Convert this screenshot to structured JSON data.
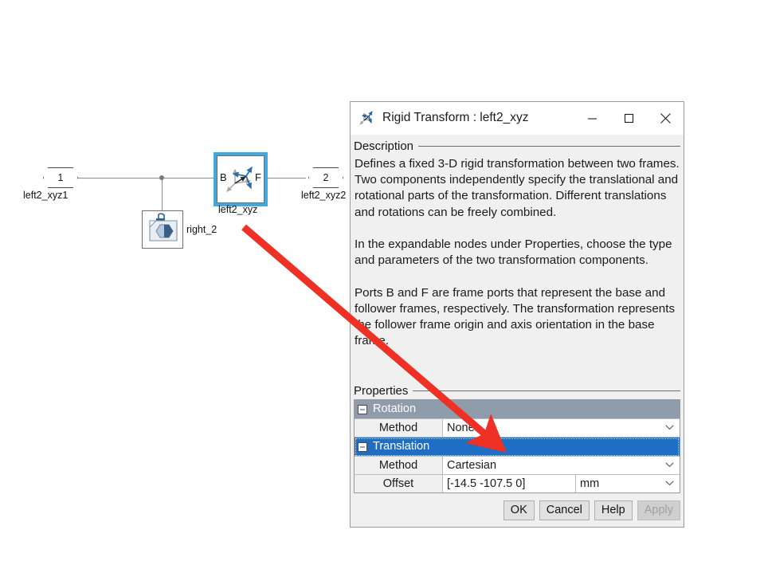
{
  "diagram": {
    "input_port": {
      "number": "1",
      "label": "left2_xyz1"
    },
    "output_port": {
      "number": "2",
      "label": "left2_xyz2"
    },
    "transform_block": {
      "label": "left2_xyz",
      "base_port": "B",
      "follower_port": "F",
      "icon": "rigid-transform-axes-icon",
      "selected": "true",
      "selection_color": "#3fa9e0"
    },
    "solid_block": {
      "label": "right_2",
      "icon": "file-solid-icon"
    },
    "annotation": {
      "type": "arrow",
      "color": "#ee3124",
      "points_to": "Translation"
    }
  },
  "dialog": {
    "title": "Rigid Transform : left2_xyz",
    "icon": "rigid-transform-axes-icon",
    "window_buttons": {
      "minimize": "minimize-icon",
      "maximize": "maximize-icon",
      "close": "close-icon"
    },
    "description": {
      "group_label": "Description",
      "text": "Defines a fixed 3-D rigid transformation between two frames. Two components independently specify the translational and rotational parts of the transformation. Different translations and rotations can be freely combined.\n\nIn the expandable nodes under Properties, choose the type and parameters of the two transformation components.\n\nPorts B and F are frame ports that represent the base and follower frames, respectively. The transformation represents the follower frame origin and axis orientation in the base frame."
    },
    "properties": {
      "group_label": "Properties",
      "rows": [
        {
          "kind": "group",
          "name": "Rotation",
          "expanded": "true",
          "selected": "false"
        },
        {
          "kind": "field",
          "label": "Method",
          "value": "None",
          "control": "dropdown"
        },
        {
          "kind": "group",
          "name": "Translation",
          "expanded": "true",
          "selected": "true"
        },
        {
          "kind": "field",
          "label": "Method",
          "value": "Cartesian",
          "control": "dropdown"
        },
        {
          "kind": "field",
          "label": "Offset",
          "value": "[-14.5 -107.5 0]",
          "unit": "mm",
          "control": "dropdown-with-unit"
        }
      ]
    },
    "buttons": [
      {
        "label": "OK",
        "disabled": "false"
      },
      {
        "label": "Cancel",
        "disabled": "false"
      },
      {
        "label": "Help",
        "disabled": "false"
      },
      {
        "label": "Apply",
        "disabled": "true"
      }
    ]
  },
  "colors": {
    "selection_blue": "#1f6ec4",
    "group_gray": "#8e9cab",
    "annotation_red": "#ee3124",
    "block_selection": "#3fa9e0"
  }
}
